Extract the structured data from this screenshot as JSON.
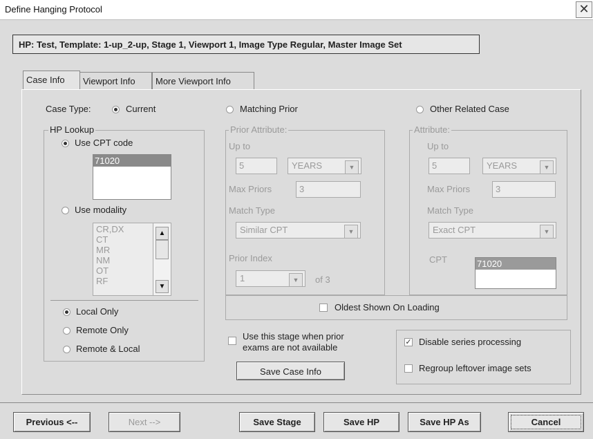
{
  "window": {
    "title": "Define Hanging Protocol",
    "close": "✕"
  },
  "hp_info": "HP: Test,  Template: 1-up_2-up,  Stage 1,  Viewport 1,  Image Type Regular,  Master Image Set",
  "tabs": [
    "Case Info",
    "Viewport Info",
    "More Viewport Info"
  ],
  "case_type": {
    "label": "Case Type:",
    "options": [
      "Current",
      "Matching Prior",
      "Other Related Case"
    ],
    "selected": "Current"
  },
  "hp_lookup": {
    "legend": "HP Lookup",
    "use_cpt_label": "Use CPT code",
    "cpt_items": [
      "71020"
    ],
    "use_modality_label": "Use modality",
    "modality_items": [
      "CR,DX",
      "CT",
      "MR",
      "NM",
      "OT",
      "RF"
    ],
    "scroll_up": "▲",
    "scroll_down": "▼",
    "location_options": [
      "Local Only",
      "Remote Only",
      "Remote & Local"
    ],
    "location_selected": "Local Only"
  },
  "matching_prior": {
    "legend": "Prior Attribute:",
    "up_to_label": "Up to",
    "up_to_value": "5",
    "up_to_unit": "YEARS",
    "max_priors_label": "Max Priors",
    "max_priors_value": "3",
    "match_type_label": "Match Type",
    "match_type_value": "Similar CPT",
    "prior_index_label": "Prior Index",
    "prior_index_value": "1",
    "of_label": "of  3",
    "oldest_label": "Oldest Shown On Loading"
  },
  "other_related": {
    "legend": "Attribute:",
    "up_to_label": "Up to",
    "up_to_value": "5",
    "up_to_unit": "YEARS",
    "max_priors_label": "Max Priors",
    "max_priors_value": "3",
    "match_type_label": "Match Type",
    "match_type_value": "Exact CPT",
    "cpt_label": "CPT",
    "cpt_items": [
      "71020"
    ]
  },
  "use_stage_label_1": "Use this stage when prior",
  "use_stage_label_2": "exams are not available",
  "save_case_info": "Save Case Info",
  "disable_series": {
    "label": "Disable series processing",
    "checked": "✓"
  },
  "regroup": {
    "label": "Regroup leftover image sets"
  },
  "footer": {
    "previous": "Previous <--",
    "next": "Next   -->",
    "save_stage": "Save Stage",
    "save_hp": "Save HP",
    "save_hp_as": "Save HP As",
    "cancel": "Cancel"
  },
  "dropdown_arrow": "▼"
}
